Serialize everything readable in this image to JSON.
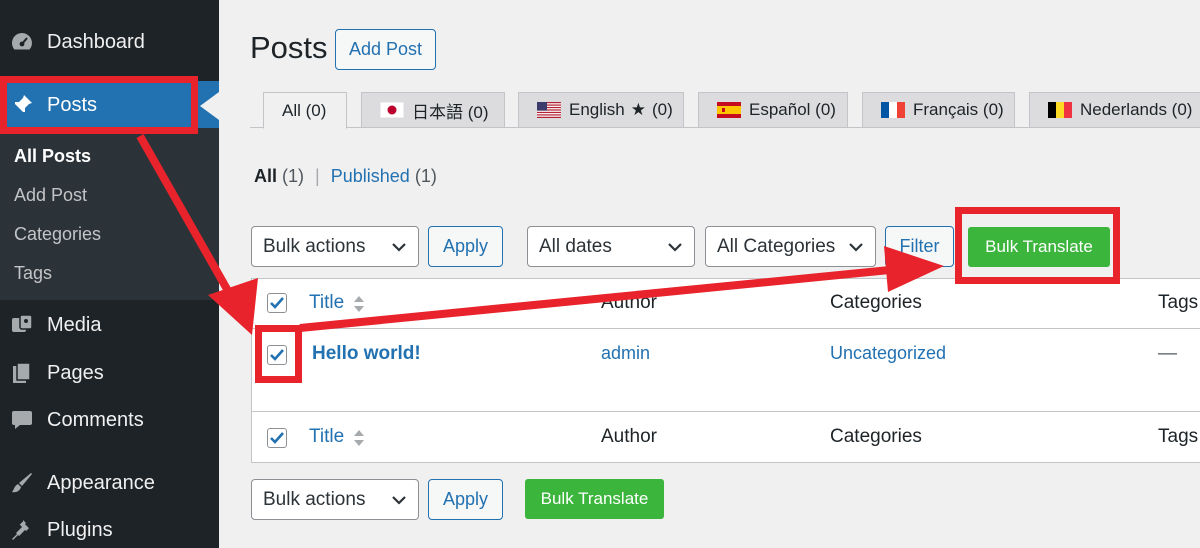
{
  "sidebar": {
    "items": [
      {
        "label": "Dashboard",
        "icon": "dashboard-icon"
      },
      {
        "label": "Posts",
        "icon": "pushpin-icon"
      },
      {
        "label": "Media",
        "icon": "media-icon"
      },
      {
        "label": "Pages",
        "icon": "pages-icon"
      },
      {
        "label": "Comments",
        "icon": "comments-icon"
      },
      {
        "label": "Appearance",
        "icon": "paintbrush-icon"
      },
      {
        "label": "Plugins",
        "icon": "plugin-icon"
      }
    ],
    "submenu": [
      "All Posts",
      "Add Post",
      "Categories",
      "Tags"
    ]
  },
  "header": {
    "title": "Posts",
    "add_button": "Add Post"
  },
  "language_tabs": [
    {
      "label": "All (0)"
    },
    {
      "label": "日本語 (0)"
    },
    {
      "label": "English",
      "count": "(0)"
    },
    {
      "label": "Español (0)"
    },
    {
      "label": "Français (0)"
    },
    {
      "label": "Nederlands (0)"
    }
  ],
  "filters": {
    "all_label": "All",
    "all_count": "(1)",
    "separator": "|",
    "published_label": "Published",
    "published_count": "(1)"
  },
  "tablenav_top": {
    "bulk_actions": "Bulk actions",
    "apply": "Apply",
    "dates": "All dates",
    "categories": "All Categories",
    "filter": "Filter",
    "bulk_translate": "Bulk Translate"
  },
  "table": {
    "columns": [
      "Title",
      "Author",
      "Categories",
      "Tags"
    ],
    "rows": [
      {
        "title": "Hello world!",
        "author": "admin",
        "categories": "Uncategorized",
        "tags": "—"
      }
    ]
  },
  "tablenav_bottom": {
    "bulk_actions": "Bulk actions",
    "apply": "Apply",
    "bulk_translate": "Bulk Translate"
  },
  "colors": {
    "sidebar_bg": "#1d2327",
    "active_blue": "#2271b1",
    "green_button": "#3bb53b",
    "annotation_red": "#e8232b"
  }
}
